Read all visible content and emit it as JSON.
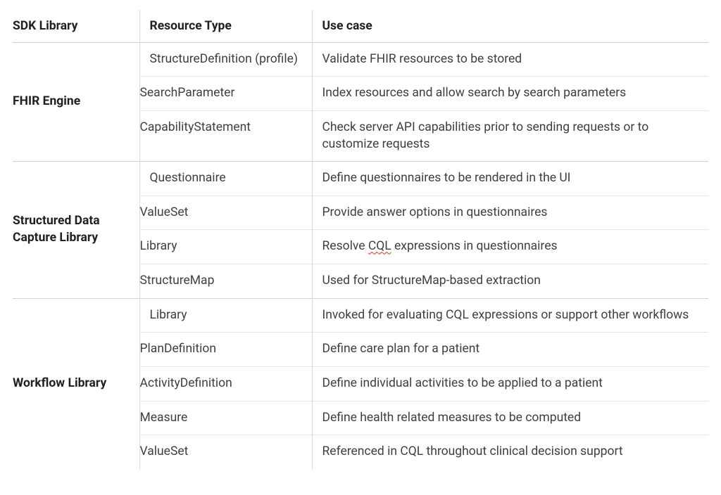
{
  "headers": {
    "lib": "SDK Library",
    "type": "Resource Type",
    "use": "Use case"
  },
  "groups": [
    {
      "lib": "FHIR Engine",
      "rows": [
        {
          "type": "StructureDefinition (profile)",
          "use": "Validate FHIR resources to be stored"
        },
        {
          "type": "SearchParameter",
          "use": "Index resources and allow search by search parameters"
        },
        {
          "type": "CapabilityStatement",
          "use": "Check server API capabilities prior to sending requests or to customize requests"
        }
      ]
    },
    {
      "lib": "Structured Data Capture Library",
      "rows": [
        {
          "type": "Questionnaire",
          "use": "Define questionnaires to be rendered in the UI"
        },
        {
          "type": "ValueSet",
          "use": "Provide answer options in questionnaires"
        },
        {
          "type": "Library",
          "use_parts": [
            "Resolve ",
            {
              "squiggle": "CQL"
            },
            " expressions in questionnaires"
          ]
        },
        {
          "type": "StructureMap",
          "use": "Used for StructureMap-based extraction"
        }
      ]
    },
    {
      "lib": "Workflow Library",
      "rows": [
        {
          "type": "Library",
          "use": "Invoked for evaluating CQL expressions or support other workflows"
        },
        {
          "type": "PlanDefinition",
          "use": "Define care plan for a patient"
        },
        {
          "type": "ActivityDefinition",
          "use": "Define individual activities to be applied to a patient"
        },
        {
          "type": "Measure",
          "use": "Define health related measures to be computed"
        },
        {
          "type": "ValueSet",
          "use": "Referenced in CQL throughout clinical decision support"
        }
      ]
    }
  ]
}
